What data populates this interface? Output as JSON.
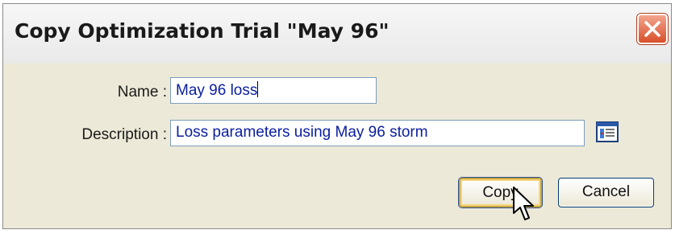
{
  "dialog": {
    "title": "Copy Optimization Trial \"May 96\"",
    "close_icon": "close-icon"
  },
  "form": {
    "name_label": "Name :",
    "name_value": "May 96 loss",
    "description_label": "Description :",
    "description_value": "Loss parameters using May 96 storm",
    "description_editor_icon": "text-editor-icon"
  },
  "buttons": {
    "copy_label": "Copy",
    "cancel_label": "Cancel"
  },
  "colors": {
    "dialog_background": "#ece9d8",
    "input_text": "#0a1ea0",
    "close_button": "#d84f2a",
    "default_button_highlight": "#f5d77e"
  }
}
